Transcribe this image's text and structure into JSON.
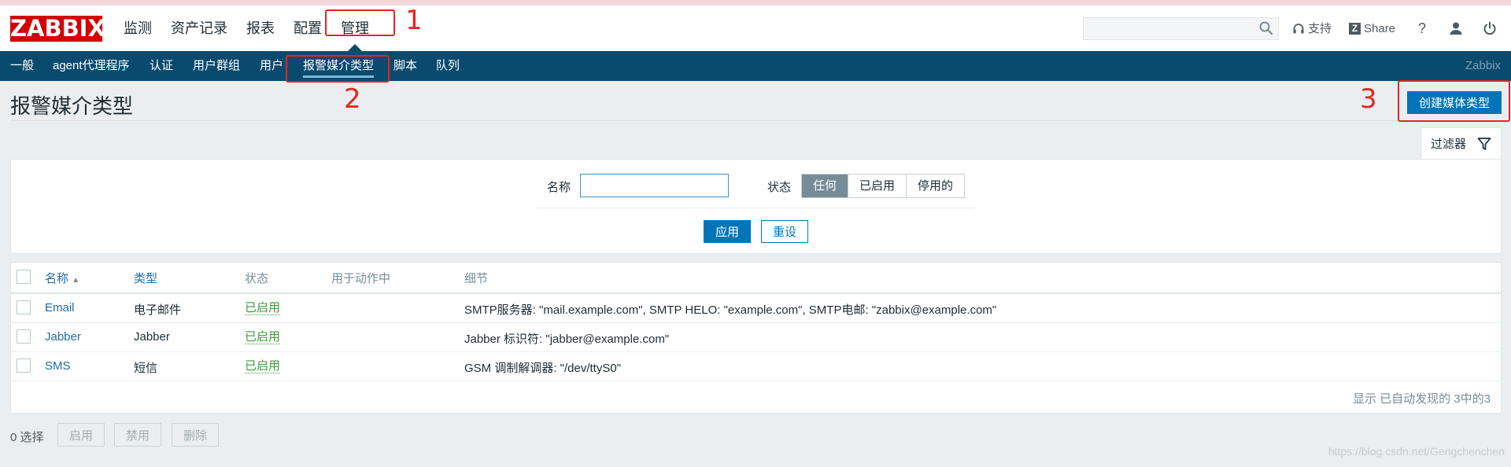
{
  "app": {
    "logo": "ZABBIX",
    "brand": "Zabbix"
  },
  "main_nav": [
    {
      "label": "监测"
    },
    {
      "label": "资产记录"
    },
    {
      "label": "报表"
    },
    {
      "label": "配置"
    },
    {
      "label": "管理",
      "active": true
    }
  ],
  "header": {
    "search_value": "",
    "support_label": "支持",
    "share_label": "Share",
    "help_label": "?"
  },
  "sub_nav": [
    {
      "label": "一般"
    },
    {
      "label": "agent代理程序"
    },
    {
      "label": "认证"
    },
    {
      "label": "用户群组"
    },
    {
      "label": "用户"
    },
    {
      "label": "报警媒介类型",
      "active": true
    },
    {
      "label": "脚本"
    },
    {
      "label": "队列"
    }
  ],
  "page": {
    "title": "报警媒介类型",
    "create_button": "创建媒体类型",
    "filter_tab": "过滤器"
  },
  "filter": {
    "name_label": "名称",
    "name_value": "",
    "status_label": "状态",
    "status_options": [
      "任何",
      "已启用",
      "停用的"
    ],
    "status_selected": "任何",
    "apply_label": "应用",
    "reset_label": "重设"
  },
  "table": {
    "columns": [
      "名称",
      "类型",
      "状态",
      "用于动作中",
      "细节"
    ],
    "rows": [
      {
        "name": "Email",
        "type": "电子邮件",
        "status": "已启用",
        "used_in_actions": "",
        "details": "SMTP服务器: \"mail.example.com\", SMTP HELO: \"example.com\", SMTP电邮: \"zabbix@example.com\""
      },
      {
        "name": "Jabber",
        "type": "Jabber",
        "status": "已启用",
        "used_in_actions": "",
        "details": "Jabber 标识符: \"jabber@example.com\""
      },
      {
        "name": "SMS",
        "type": "短信",
        "status": "已启用",
        "used_in_actions": "",
        "details": "GSM 调制解调器: \"/dev/ttyS0\""
      }
    ],
    "footer": "显示 已自动发现的 3中的3"
  },
  "bulk": {
    "selected_count": "0 选择",
    "enable_label": "启用",
    "disable_label": "禁用",
    "delete_label": "删除"
  },
  "annotations": [
    "1",
    "2",
    "3"
  ],
  "watermark": "https://blog.csdn.net/Gengchenchen",
  "colors": {
    "logo": "#d40000",
    "subnav": "#0b4a6f",
    "primary": "#0275b8",
    "status_enabled": "#3b9b3b",
    "annotation": "#e8251e"
  }
}
